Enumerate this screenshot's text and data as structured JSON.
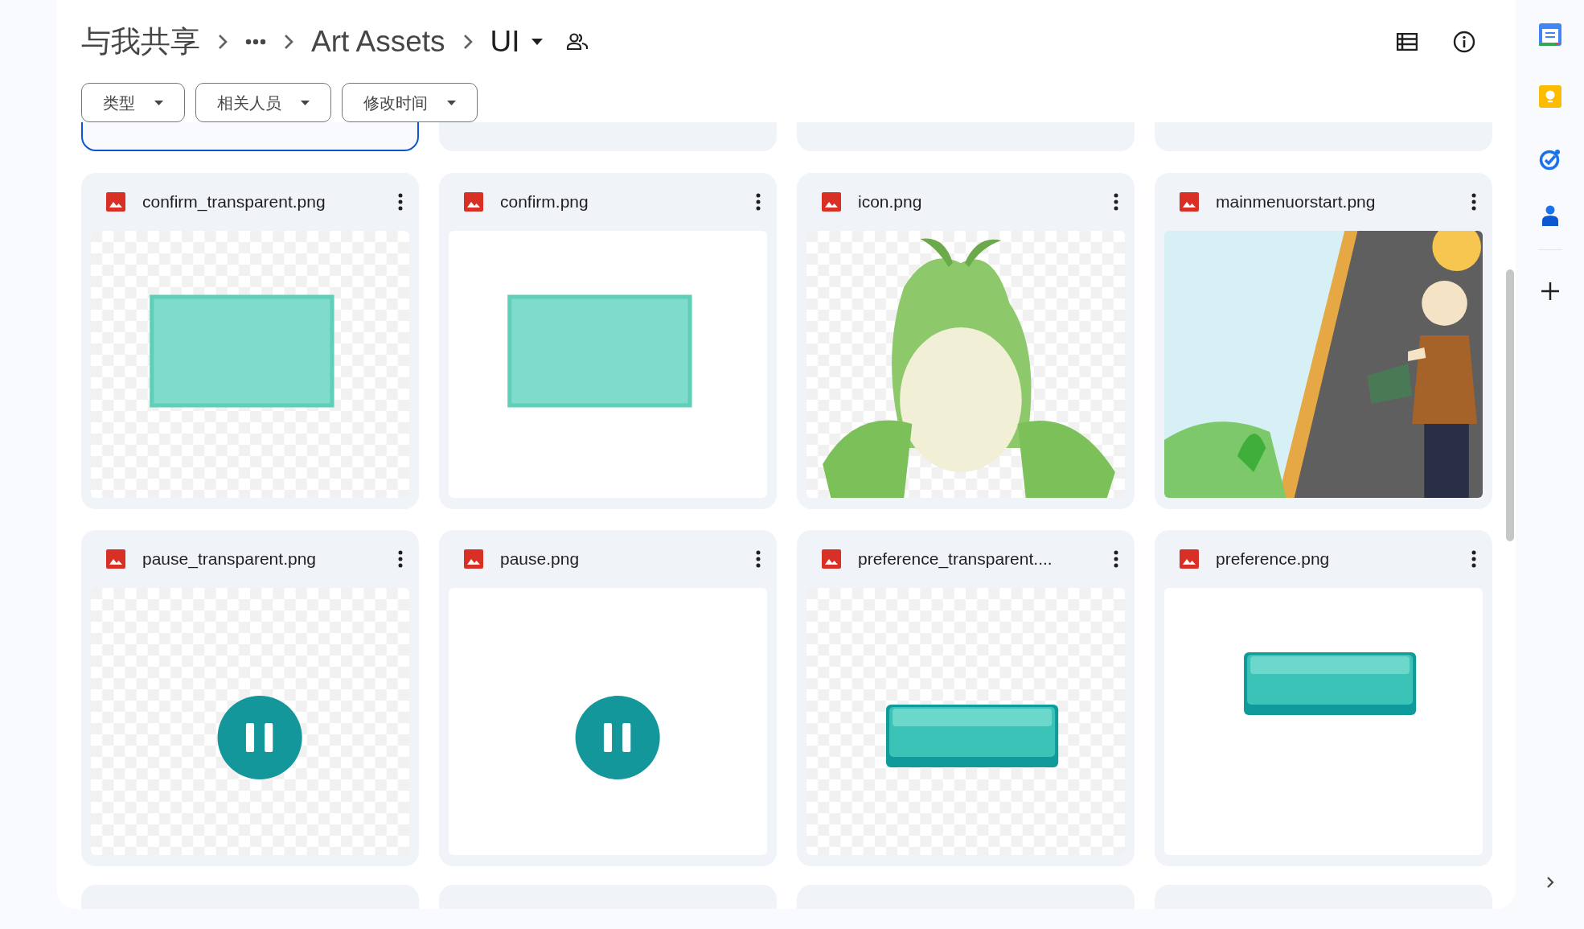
{
  "breadcrumb": {
    "root": "与我共享",
    "parent": "Art Assets",
    "current": "UI"
  },
  "filters": [
    "类型",
    "相关人员",
    "修改时间"
  ],
  "cards_above": [
    {
      "selected": true
    },
    {
      "selected": false
    },
    {
      "selected": false
    },
    {
      "selected": false
    }
  ],
  "files": [
    {
      "name": "confirm_transparent.png",
      "selected": false
    },
    {
      "name": "confirm.png",
      "selected": false
    },
    {
      "name": "icon.png",
      "selected": false
    },
    {
      "name": "mainmenuorstart.png",
      "selected": false
    },
    {
      "name": "pause_transparent.png",
      "selected": false
    },
    {
      "name": "pause.png",
      "selected": false
    },
    {
      "name": "preference_transparent....",
      "selected": false
    },
    {
      "name": "preference.png",
      "selected": false
    }
  ],
  "cards_below": [
    {
      "selected": false
    },
    {
      "selected": false
    },
    {
      "selected": false
    },
    {
      "selected": false
    }
  ]
}
